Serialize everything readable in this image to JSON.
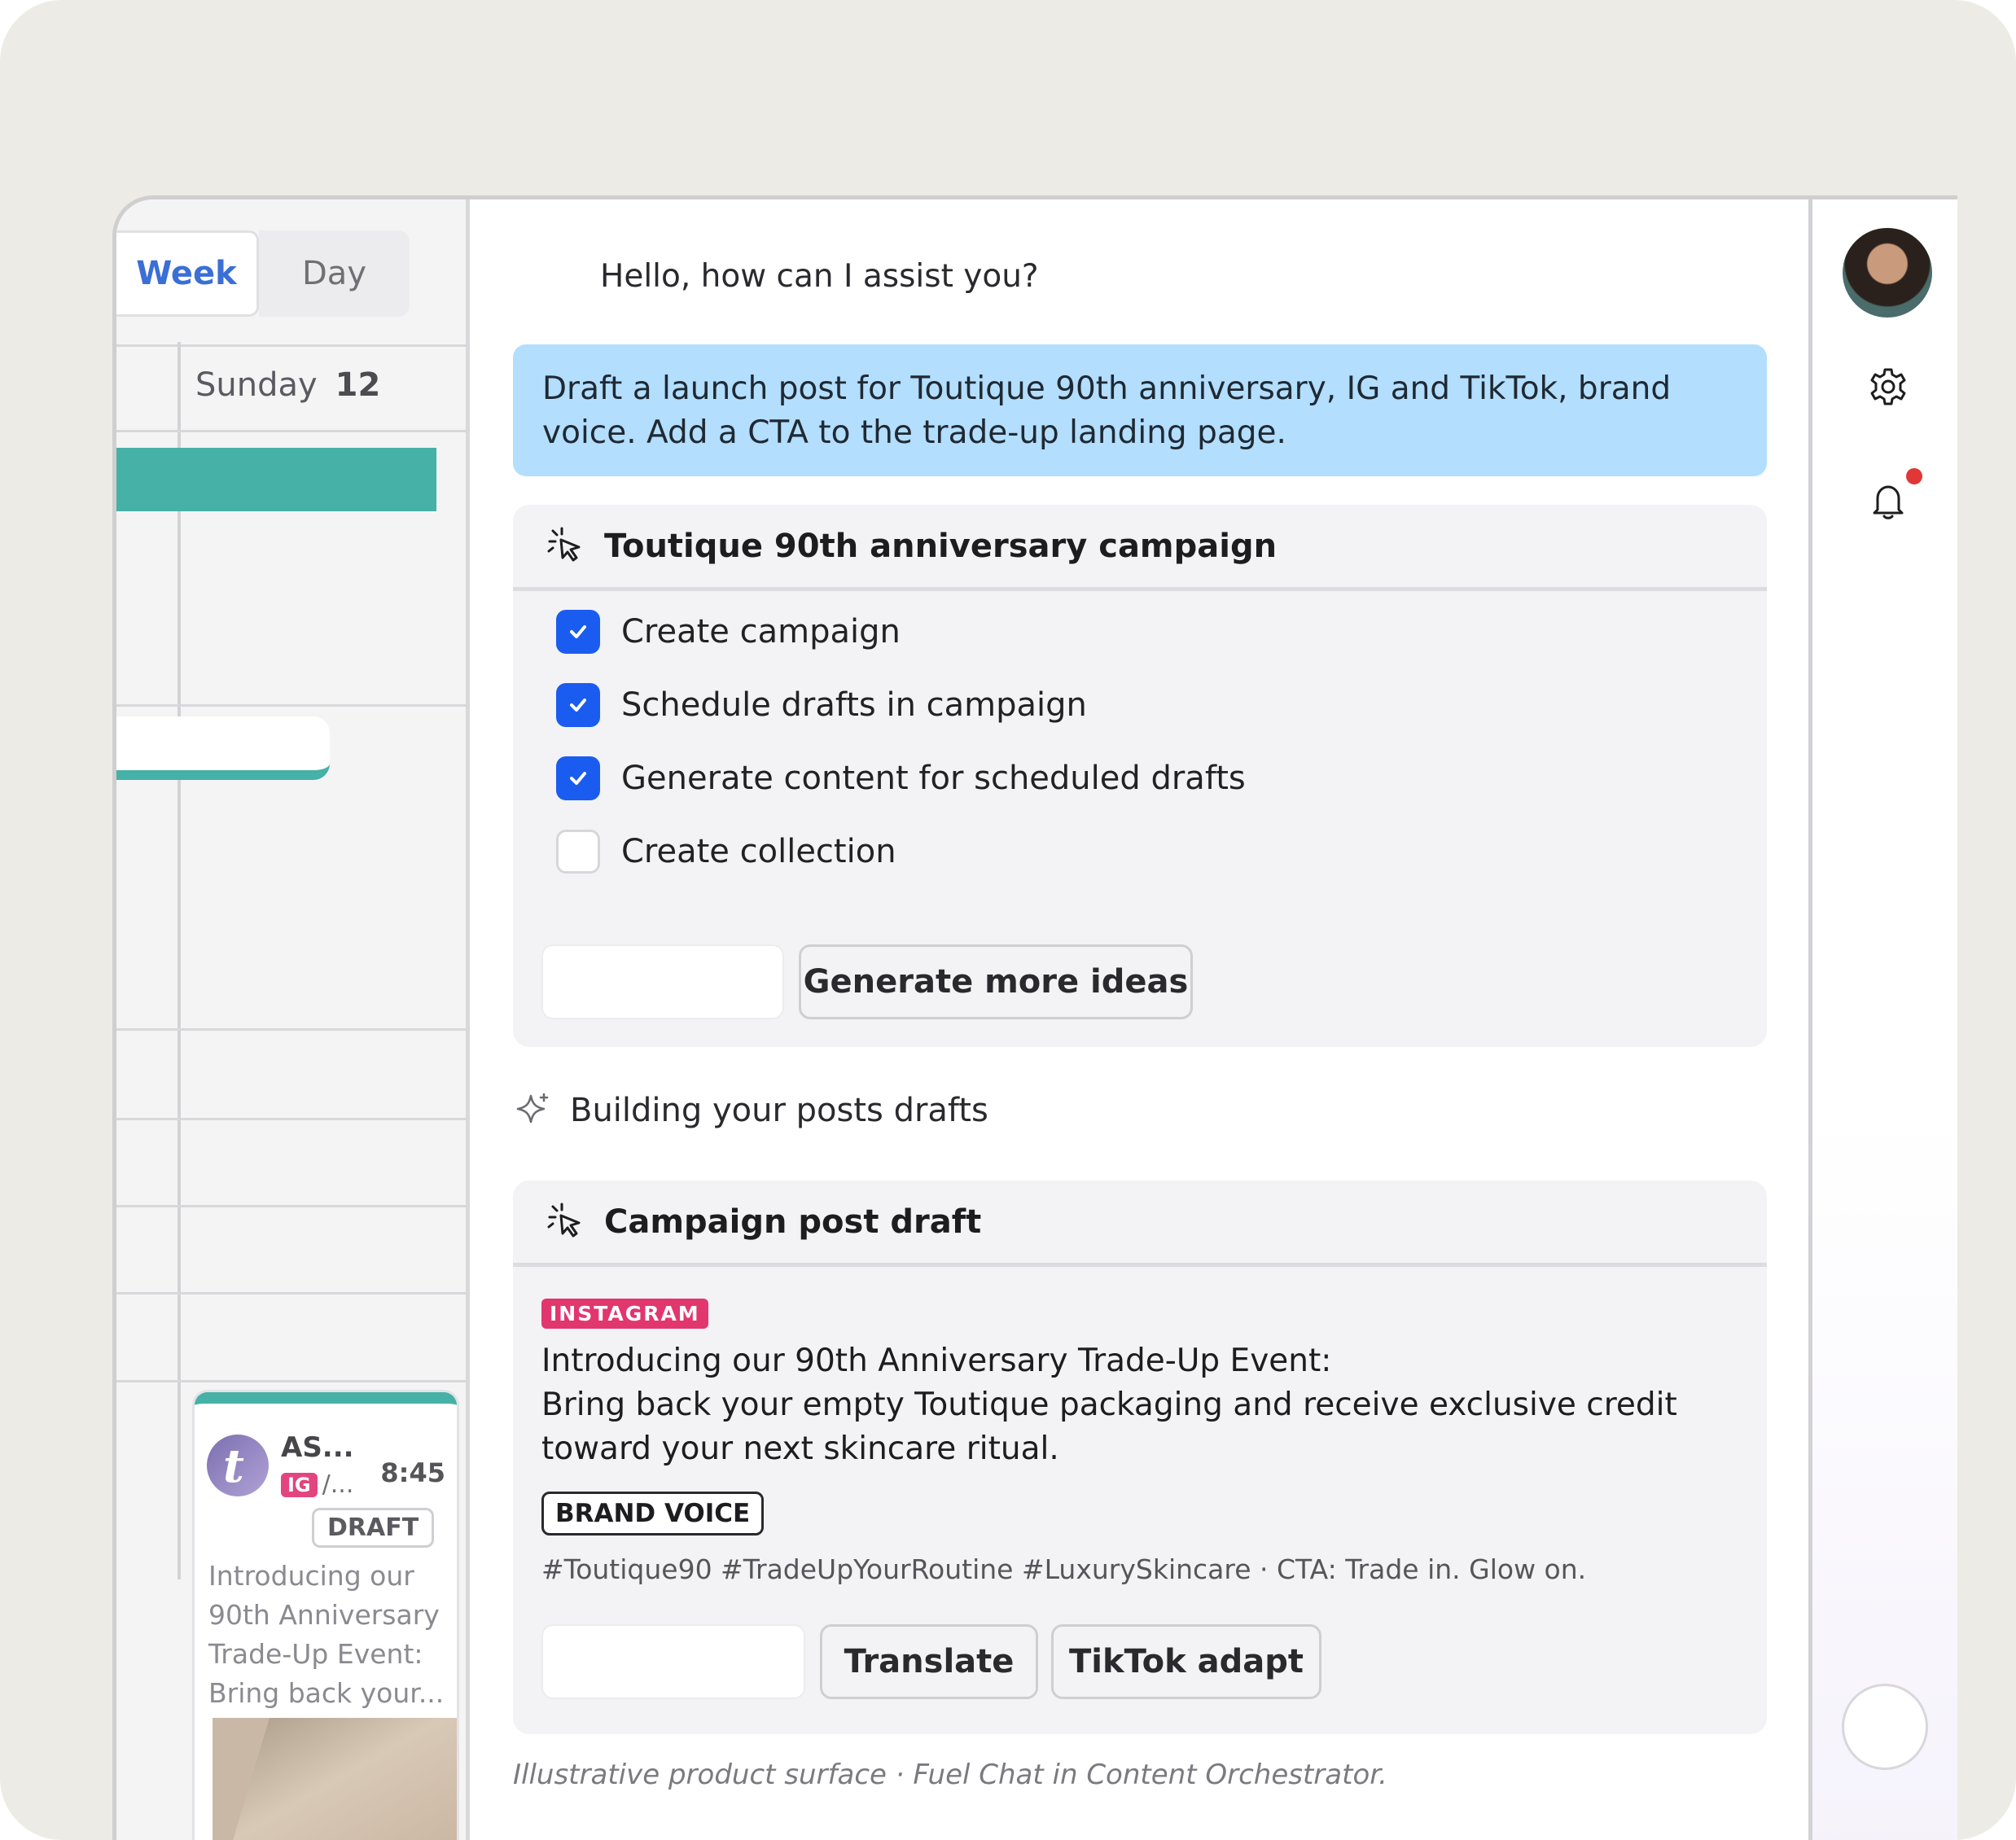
{
  "calendar": {
    "view_week": "Week",
    "view_day": "Day",
    "day_name": "Sunday",
    "day_number": "12",
    "post_card": {
      "account": "AS...",
      "platform_tag": "IG",
      "platform_more": "/...",
      "time": "8:45",
      "status": "DRAFT",
      "preview": "Introducing our 90th Anniversary Trade-Up Event: Bring back your..."
    }
  },
  "chat": {
    "greeting": "Hello, how can I assist you?",
    "user_message": "Draft a launch post for Toutique 90th anniversary, IG and TikTok, brand voice. Add a CTA to the trade-up landing page.",
    "campaign_panel": {
      "title": "Toutique 90th anniversary campaign",
      "tasks": [
        {
          "label": "Create campaign",
          "done": true
        },
        {
          "label": "Schedule drafts in campaign",
          "done": true
        },
        {
          "label": "Generate content for scheduled drafts",
          "done": true
        },
        {
          "label": "Create collection",
          "done": false
        }
      ],
      "more_ideas_button": "Generate more ideas"
    },
    "status_text": "Building your posts drafts",
    "draft_panel": {
      "title": "Campaign post draft",
      "platform": "INSTAGRAM",
      "post_line1": "Introducing our 90th Anniversary Trade-Up Event:",
      "post_line2": "Bring back your empty Toutique packaging and receive exclusive credit toward your next skincare ritual.",
      "voice_badge": "BRAND VOICE",
      "hashtags": "#Toutique90 #TradeUpYourRoutine #LuxurySkincare · CTA: Trade in. Glow on.",
      "translate_button": "Translate",
      "tiktok_button": "TikTok adapt"
    },
    "footnote": "Illustrative product surface · Fuel Chat in Content Orchestrator."
  },
  "rail": {
    "icons": [
      "avatar",
      "gear-icon",
      "bell-icon"
    ]
  },
  "colors": {
    "accent_blue": "#1b5cf0",
    "teal": "#46b1a6",
    "user_bubble": "#b3defd",
    "instagram": "#e2366f",
    "notification": "#e23737"
  }
}
